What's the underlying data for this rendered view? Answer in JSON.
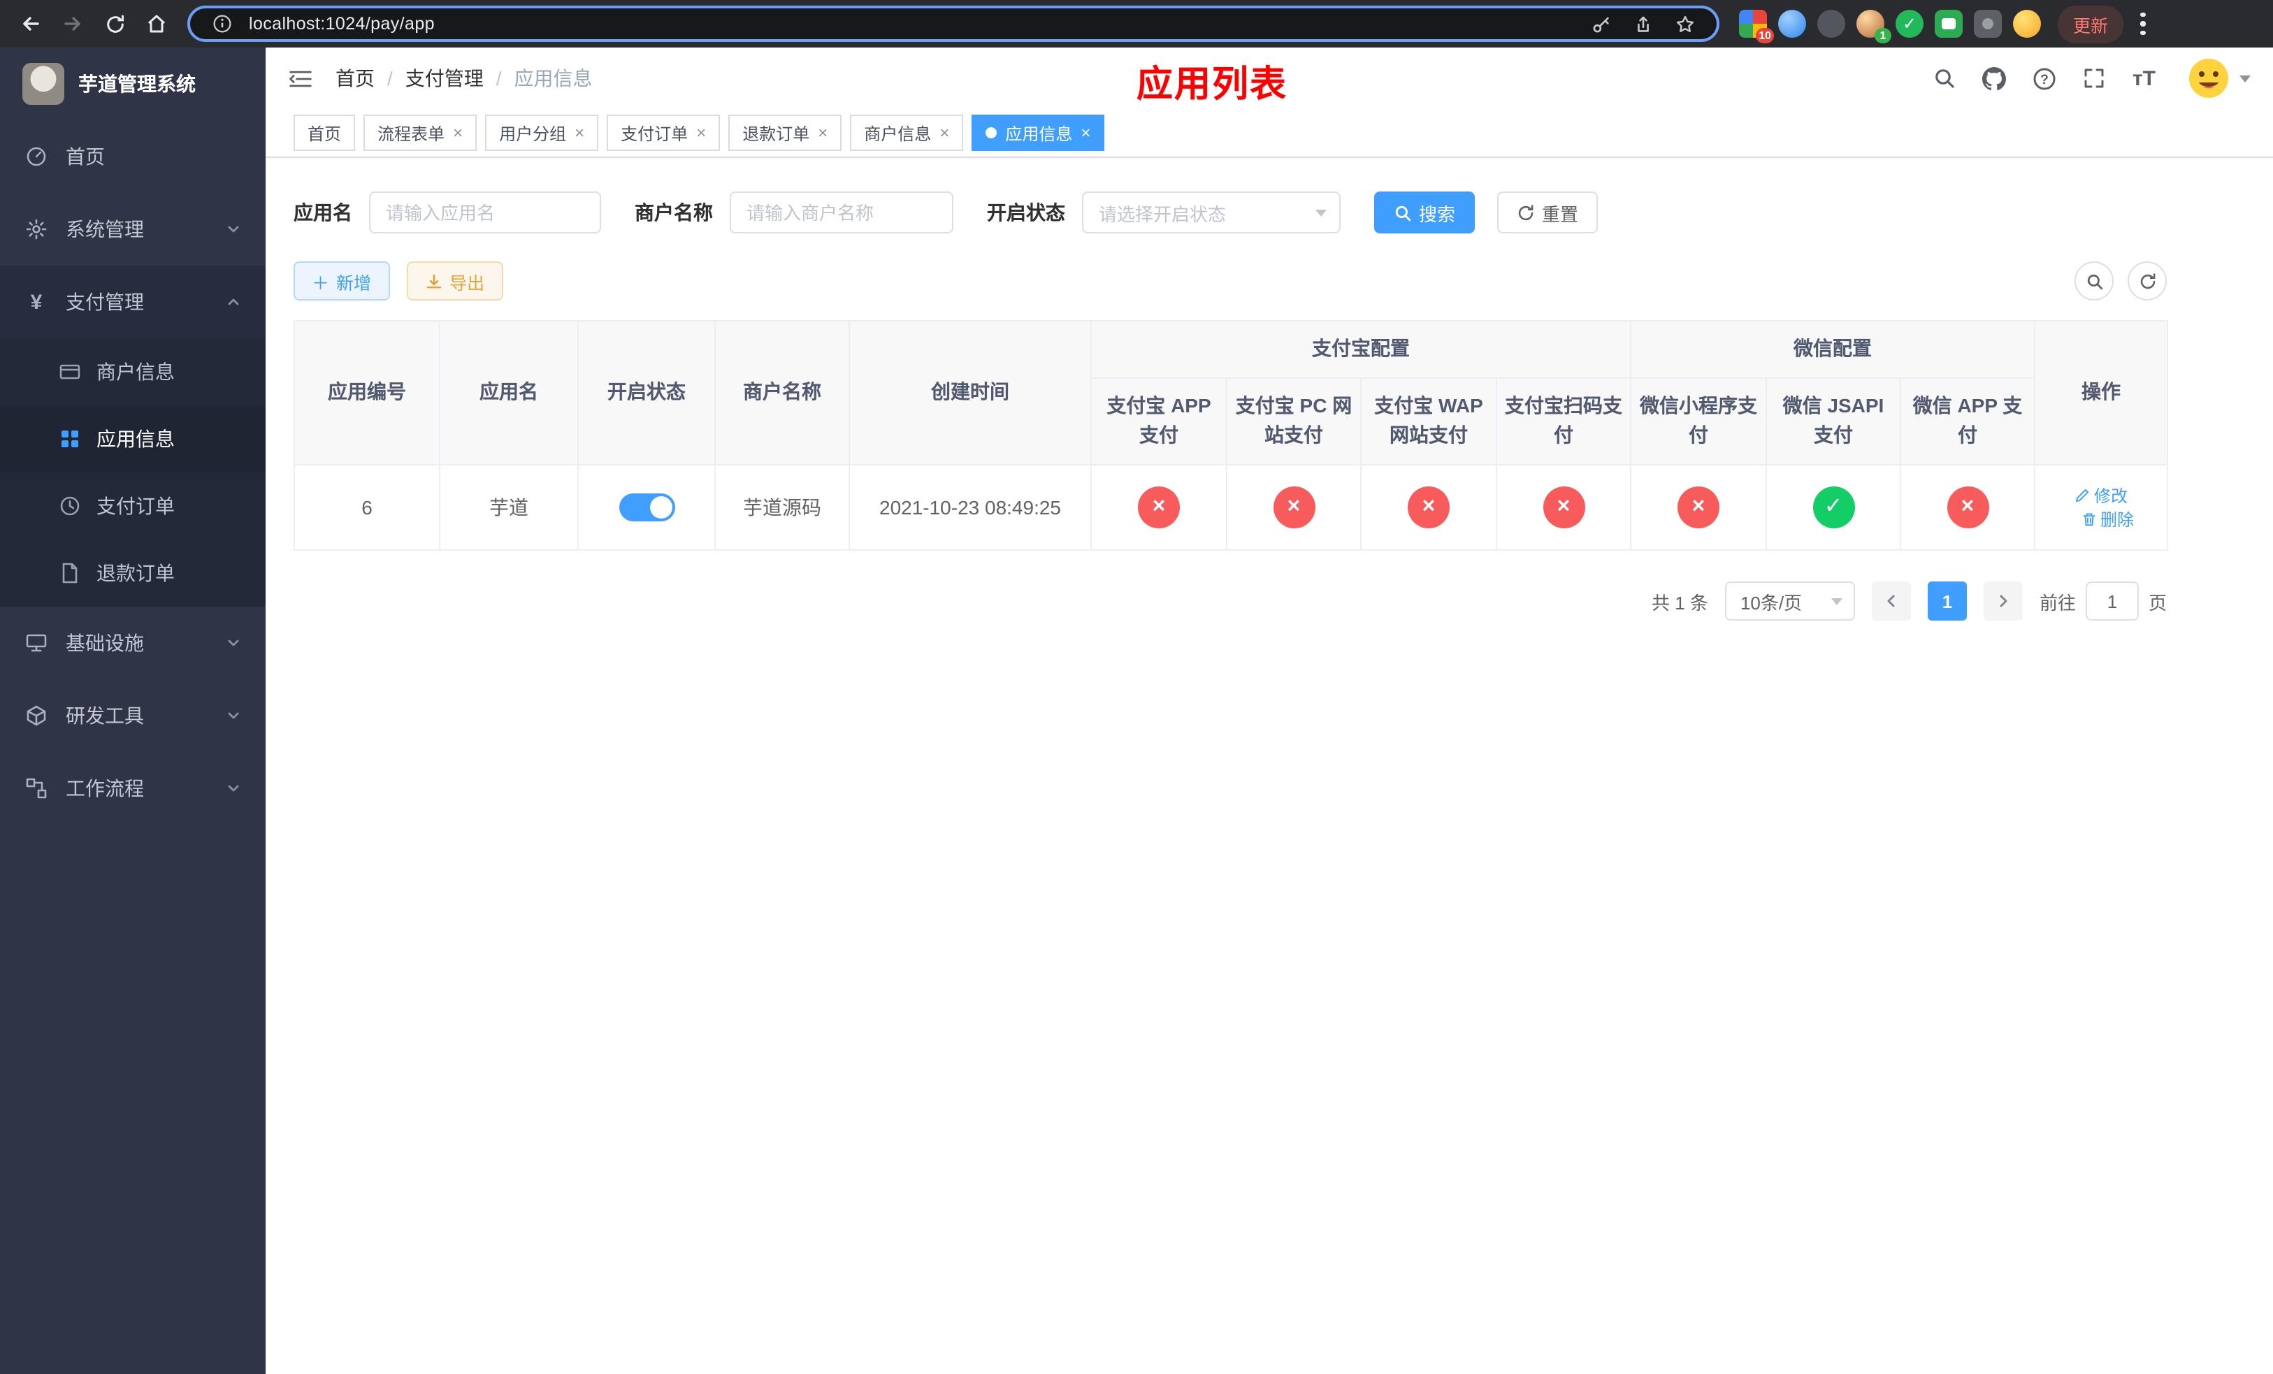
{
  "browser": {
    "url": "localhost:1024/pay/app",
    "update_label": "更新",
    "ext_badge_grid": "10",
    "ext_badge_avatar": "1"
  },
  "sidebar": {
    "title": "芋道管理系统",
    "items": [
      {
        "label": "首页"
      },
      {
        "label": "系统管理"
      },
      {
        "label": "支付管理",
        "children": [
          {
            "label": "商户信息"
          },
          {
            "label": "应用信息"
          },
          {
            "label": "支付订单"
          },
          {
            "label": "退款订单"
          }
        ]
      },
      {
        "label": "基础设施"
      },
      {
        "label": "研发工具"
      },
      {
        "label": "工作流程"
      }
    ]
  },
  "header": {
    "breadcrumb": [
      "首页",
      "支付管理",
      "应用信息"
    ],
    "page_title": "应用列表"
  },
  "tabs": [
    {
      "label": "首页"
    },
    {
      "label": "流程表单"
    },
    {
      "label": "用户分组"
    },
    {
      "label": "支付订单"
    },
    {
      "label": "退款订单"
    },
    {
      "label": "商户信息"
    },
    {
      "label": "应用信息"
    }
  ],
  "filters": {
    "app_name_label": "应用名",
    "app_name_placeholder": "请输入应用名",
    "merchant_label": "商户名称",
    "merchant_placeholder": "请输入商户名称",
    "status_label": "开启状态",
    "status_placeholder": "请选择开启状态",
    "search_button": "搜索",
    "reset_button": "重置"
  },
  "toolbar": {
    "add_button": "新增",
    "export_button": "导出"
  },
  "table": {
    "col_app_id": "应用编号",
    "col_app_name": "应用名",
    "col_status": "开启状态",
    "col_merchant": "商户名称",
    "col_created": "创建时间",
    "group_alipay": "支付宝配置",
    "group_wechat": "微信配置",
    "col_alipay_app": "支付宝 APP 支付",
    "col_alipay_pc": "支付宝 PC 网站支付",
    "col_alipay_wap": "支付宝 WAP 网站支付",
    "col_alipay_qr": "支付宝扫码支付",
    "col_wx_mini": "微信小程序支付",
    "col_wx_jsapi": "微信 JSAPI 支付",
    "col_wx_app": "微信 APP 支付",
    "col_actions": "操作",
    "rows": [
      {
        "id": "6",
        "name": "芋道",
        "enabled": true,
        "merchant": "芋道源码",
        "created": "2021-10-23 08:49:25",
        "channels": [
          false,
          false,
          false,
          false,
          false,
          true,
          false
        ],
        "edit_label": "修改",
        "delete_label": "删除"
      }
    ]
  },
  "pagination": {
    "total": "共 1 条",
    "page_size": "10条/页",
    "current_page": "1",
    "goto_label": "前往",
    "goto_value": "1",
    "goto_suffix": "页"
  },
  "colors": {
    "primary": "#409eff",
    "danger": "#f85b5b",
    "success": "#13ce66",
    "title_red": "#ff0000"
  }
}
